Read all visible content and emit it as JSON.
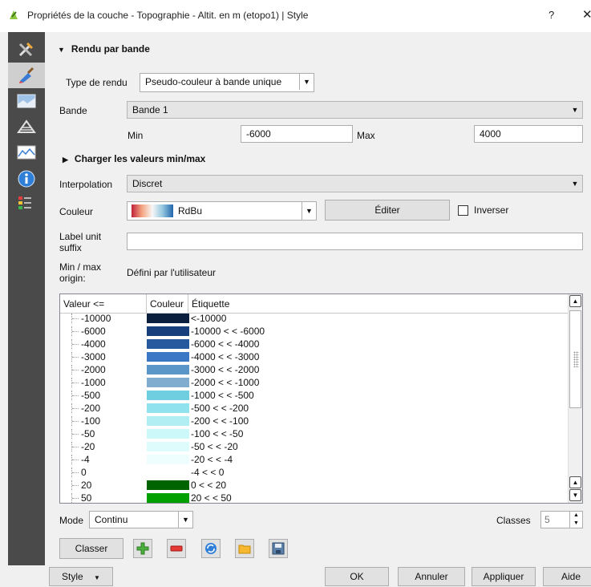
{
  "window": {
    "title": "Propriétés de la couche - Topographie - Altit. en m (etopo1) | Style",
    "help": "?",
    "close": "✕"
  },
  "sidebar": {
    "items": [
      {
        "icon": "tools-icon",
        "active": false
      },
      {
        "icon": "paintbrush-icon",
        "active": true
      },
      {
        "icon": "transparency-icon",
        "active": false
      },
      {
        "icon": "pyramids-icon",
        "active": false
      },
      {
        "icon": "histogram-icon",
        "active": false
      },
      {
        "icon": "info-icon",
        "active": false
      },
      {
        "icon": "legend-icon",
        "active": false
      }
    ]
  },
  "render": {
    "section_title": "Rendu par bande",
    "type_label": "Type de rendu",
    "type_value": "Pseudo-couleur à bande unique",
    "band_label": "Bande",
    "band_value": "Bande 1",
    "min_label": "Min",
    "min_value": "-6000",
    "max_label": "Max",
    "max_value": "4000",
    "load_minmax_label": "Charger les valeurs min/max",
    "interp_label": "Interpolation",
    "interp_value": "Discret",
    "color_label": "Couleur",
    "ramp_name": "RdBu",
    "edit_button": "Éditer",
    "invert_label": "Inverser",
    "unit_suffix_label": "Label unit suffix",
    "unit_suffix_value": "",
    "origin_label": "Min / max origin:",
    "origin_value": "Défini par l'utilisateur"
  },
  "table": {
    "headers": [
      "Valeur <=",
      "Couleur",
      "Étiquette"
    ],
    "rows": [
      {
        "value": "-10000",
        "color": "#0a1f3d",
        "label": "<-10000"
      },
      {
        "value": "-6000",
        "color": "#173f7c",
        "label": "-10000 < < -6000"
      },
      {
        "value": "-4000",
        "color": "#27599e",
        "label": "-6000 < < -4000"
      },
      {
        "value": "-3000",
        "color": "#3a78c5",
        "label": "-4000 < < -3000"
      },
      {
        "value": "-2000",
        "color": "#5b96c9",
        "label": "-3000 < < -2000"
      },
      {
        "value": "-1000",
        "color": "#7faccf",
        "label": "-2000 < < -1000"
      },
      {
        "value": "-500",
        "color": "#6fcfe0",
        "label": "-1000 < < -500"
      },
      {
        "value": "-200",
        "color": "#8fe2ee",
        "label": "-500 < < -200"
      },
      {
        "value": "-100",
        "color": "#b0eef4",
        "label": "-200 < < -100"
      },
      {
        "value": "-50",
        "color": "#cdf8fa",
        "label": "-100 < < -50"
      },
      {
        "value": "-20",
        "color": "#defcfc",
        "label": "-50 < < -20"
      },
      {
        "value": "-4",
        "color": "#eefefe",
        "label": "-20 < < -4"
      },
      {
        "value": "0",
        "color": "#ffffff",
        "label": "-4 < < 0"
      },
      {
        "value": "20",
        "color": "#006400",
        "label": "0 < < 20"
      },
      {
        "value": "50",
        "color": "#00a000",
        "label": "20 < < 50"
      }
    ]
  },
  "mode": {
    "label": "Mode",
    "value": "Continu",
    "classes_label": "Classes",
    "classes_value": "5"
  },
  "actions": {
    "classify_button": "Classer"
  },
  "footer": {
    "style_button": "Style",
    "ok_button": "OK",
    "cancel_button": "Annuler",
    "apply_button": "Appliquer",
    "help_button": "Aide"
  }
}
